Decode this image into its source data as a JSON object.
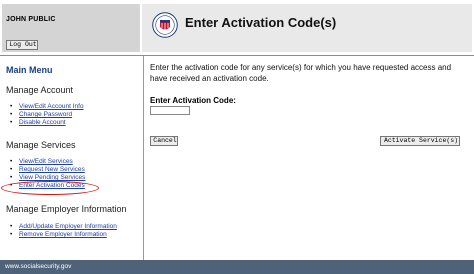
{
  "user": {
    "name": "JOHN PUBLIC",
    "logout_label": "Log Out"
  },
  "header": {
    "title": "Enter Activation Code(s)",
    "seal_icon": "ssa-seal-icon"
  },
  "sidebar": {
    "menu_title": "Main Menu",
    "sections": [
      {
        "title": "Manage Account",
        "links": [
          "View/Edit Account Info",
          "Change Password",
          "Disable Account"
        ]
      },
      {
        "title": "Manage Services",
        "links": [
          "View/Edit Services",
          "Request New Services",
          "View Pending Services",
          "Enter Activation Codes"
        ]
      },
      {
        "title": "Manage Employer Information",
        "links": [
          "Add/Update Employer Information",
          "Remove Employer Information"
        ]
      }
    ],
    "highlight_color": "#d01818"
  },
  "main": {
    "instructions": "Enter the activation code for any service(s) for which you have requested access and have received an activation code.",
    "code_label": "Enter Activation Code:",
    "code_value": "",
    "cancel_label": "Cancel",
    "activate_label": "Activate Service(s)"
  },
  "footer": {
    "text": "www.socialsecurity.gov",
    "color": "#4e6379"
  }
}
